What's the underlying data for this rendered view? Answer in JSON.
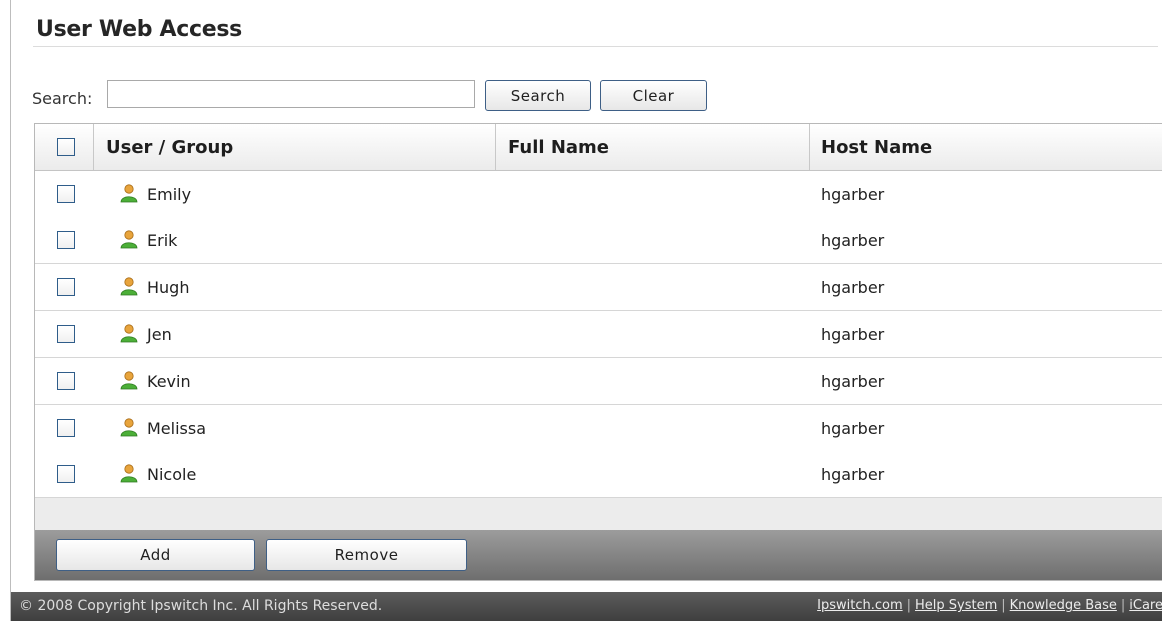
{
  "page": {
    "title": "User Web Access"
  },
  "search": {
    "label": "Search:",
    "value": "",
    "placeholder": "",
    "search_button": "Search",
    "clear_button": "Clear"
  },
  "grid": {
    "columns": [
      "User / Group",
      "Full Name",
      "Host Name"
    ],
    "rows": [
      {
        "user": "Emily",
        "full_name": "",
        "host": "hgarber",
        "icon": "user-icon"
      },
      {
        "user": "Erik",
        "full_name": "",
        "host": "hgarber",
        "icon": "user-icon"
      },
      {
        "user": "Hugh",
        "full_name": "",
        "host": "hgarber",
        "icon": "user-icon"
      },
      {
        "user": "Jen",
        "full_name": "",
        "host": "hgarber",
        "icon": "user-icon"
      },
      {
        "user": "Kevin",
        "full_name": "",
        "host": "hgarber",
        "icon": "user-icon"
      },
      {
        "user": "Melissa",
        "full_name": "",
        "host": "hgarber",
        "icon": "user-icon"
      },
      {
        "user": "Nicole",
        "full_name": "",
        "host": "hgarber",
        "icon": "user-icon"
      }
    ],
    "add_button": "Add",
    "remove_button": "Remove"
  },
  "footer": {
    "copyright": "© 2008 Copyright Ipswitch Inc. All Rights Reserved.",
    "links": [
      "Ipswitch.com",
      "Help System",
      "Knowledge Base",
      "iCare"
    ]
  },
  "colors": {
    "button_border": "#3e5f86",
    "checkbox_border": "#2f5d8a",
    "footer_bar": "#4a4a4a",
    "grid_footer": "#858585"
  }
}
